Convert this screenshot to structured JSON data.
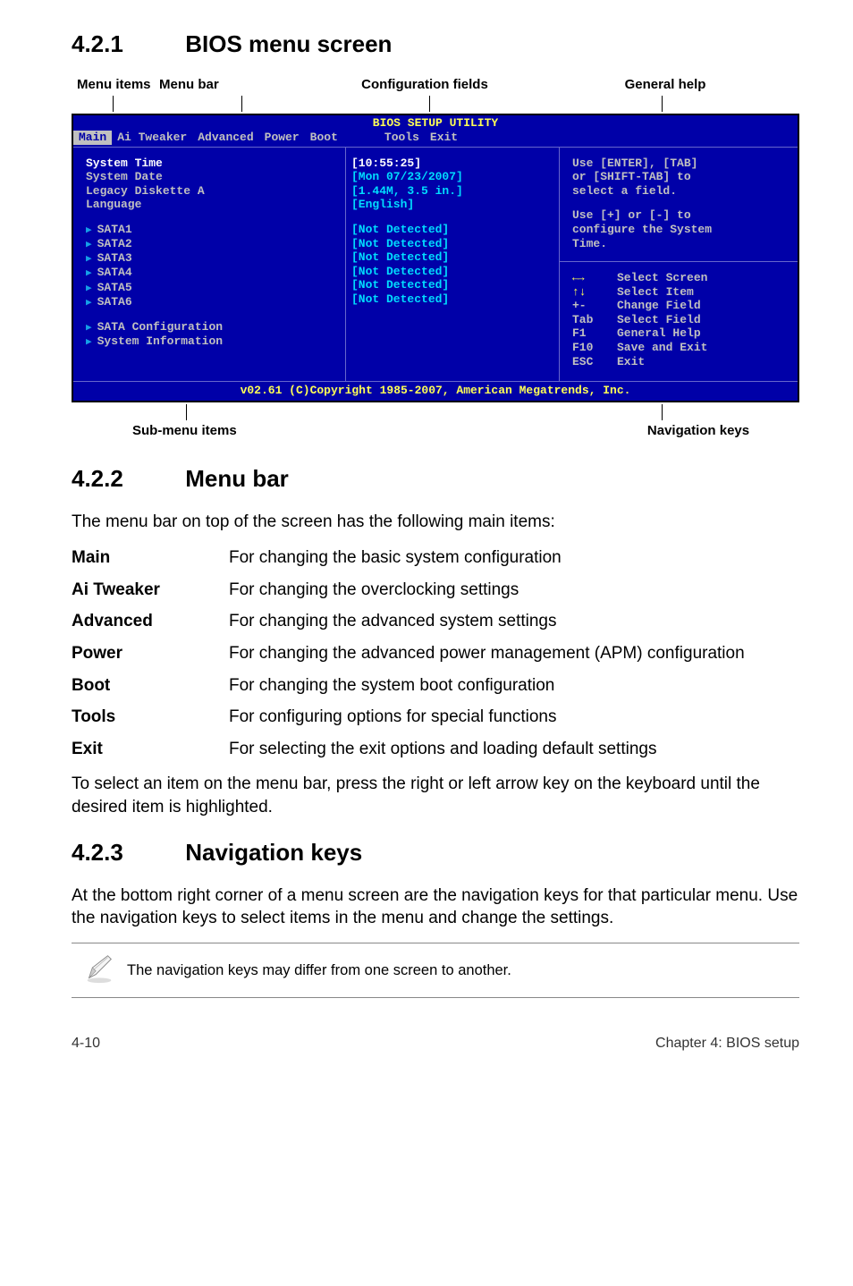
{
  "sections": {
    "s1": {
      "num": "4.2.1",
      "title": "BIOS menu screen"
    },
    "s2": {
      "num": "4.2.2",
      "title": "Menu bar"
    },
    "s3": {
      "num": "4.2.3",
      "title": "Navigation keys"
    }
  },
  "labels_top": {
    "menu_items": "Menu items",
    "menu_bar": "Menu bar",
    "config_fields": "Configuration fields",
    "general_help": "General help"
  },
  "bios": {
    "title": "BIOS SETUP UTILITY",
    "menubar": [
      "Main",
      "Ai Tweaker",
      "Advanced",
      "Power",
      "Boot",
      "Tools",
      "Exit"
    ],
    "left": {
      "system_time": "System Time",
      "system_date": "System Date",
      "legacy": "Legacy Diskette A",
      "language": "Language",
      "sata": [
        "SATA1",
        "SATA2",
        "SATA3",
        "SATA4",
        "SATA5",
        "SATA6"
      ],
      "sata_config": "SATA Configuration",
      "sys_info": "System Information"
    },
    "mid": {
      "time": "[10:55:25]",
      "date": "[Mon 07/23/2007]",
      "legacy_val": "[1.44M, 3.5 in.]",
      "lang_val": "[English]",
      "nd": "[Not Detected]"
    },
    "right": {
      "help1": "Use [ENTER], [TAB]",
      "help2": "or [SHIFT-TAB] to",
      "help3": "select a field.",
      "help4": "Use [+] or [-] to",
      "help5": "configure the System",
      "help6": "Time.",
      "nav": {
        "select_screen": "Select Screen",
        "select_item": "Select Item",
        "change_field": "Change Field",
        "select_field": "Select Field",
        "general_help": "General Help",
        "save_exit": "Save and Exit",
        "exit": "Exit",
        "k_pm": "+-",
        "k_tab": "Tab",
        "k_f1": "F1",
        "k_f10": "F10",
        "k_esc": "ESC"
      }
    },
    "foot": "v02.61 (C)Copyright 1985-2007, American Megatrends, Inc."
  },
  "labels_bottom": {
    "submenu": "Sub-menu items",
    "navkeys": "Navigation keys"
  },
  "menubar_intro": "The menu bar on top of the screen has the following main items:",
  "menubar_items": {
    "main": {
      "k": "Main",
      "v": "For changing the basic system configuration"
    },
    "ait": {
      "k": "Ai Tweaker",
      "v": "For changing the overclocking settings"
    },
    "adv": {
      "k": "Advanced",
      "v": "For changing the advanced system settings"
    },
    "pwr": {
      "k": "Power",
      "v": "For changing the advanced power management (APM) configuration"
    },
    "boot": {
      "k": "Boot",
      "v": "For changing the system boot configuration"
    },
    "tools": {
      "k": "Tools",
      "v": "For configuring options for special functions"
    },
    "exit": {
      "k": "Exit",
      "v": "For selecting the exit options and loading default settings"
    }
  },
  "menubar_outro": "To select an item on the menu bar, press the right or left arrow key on the keyboard until the desired item is highlighted.",
  "navkeys_para": "At the bottom right corner of a menu screen are the navigation keys for that particular menu. Use the navigation keys to select items in the menu and change the settings.",
  "note": "The navigation keys may differ from one screen to another.",
  "footer": {
    "left": "4-10",
    "right": "Chapter 4: BIOS setup"
  }
}
